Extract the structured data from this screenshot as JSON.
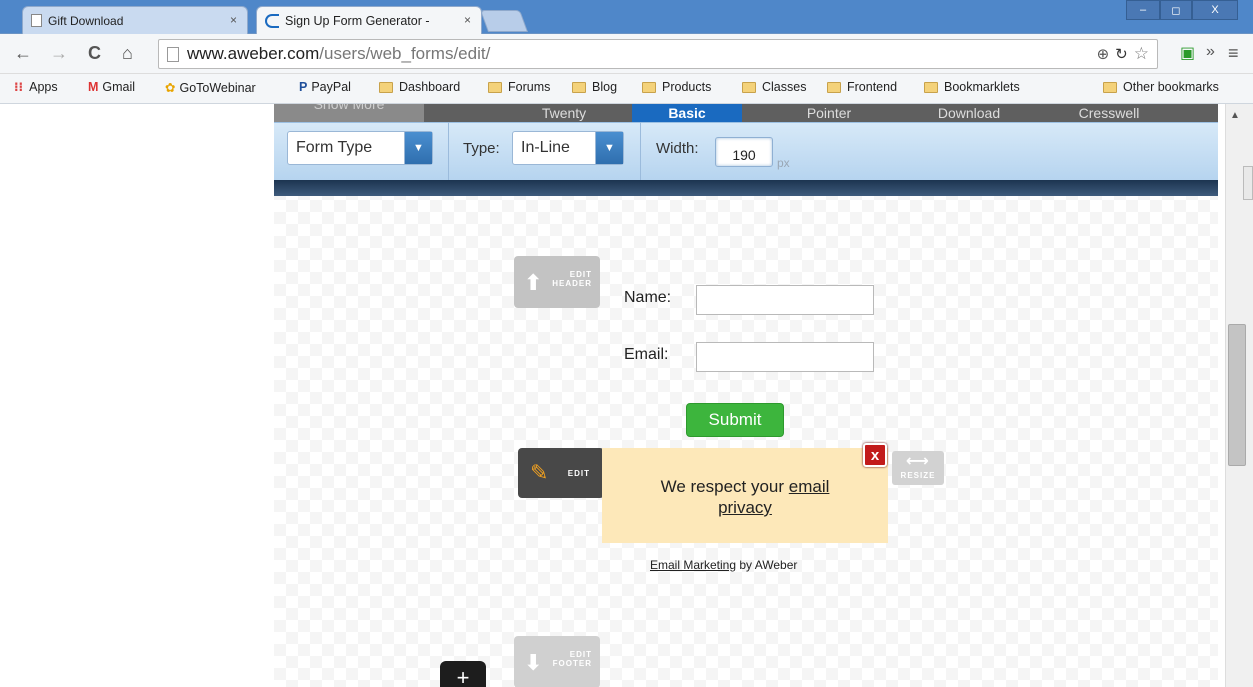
{
  "tabs": [
    {
      "title": "Gift Download",
      "close": "×"
    },
    {
      "title": "Sign Up Form Generator -",
      "close": "×"
    }
  ],
  "window_controls": {
    "minimize": "–",
    "maximize": "◻",
    "close": "X"
  },
  "toolbar": {
    "url_host": "www.aweber.com",
    "url_path": "/users/web_forms/edit/",
    "back": "←",
    "forward": "→",
    "reload": "C",
    "home": "⌂",
    "overflow": "»",
    "menu": "≡"
  },
  "bookmarks": {
    "apps": "Apps",
    "items": [
      "Gmail",
      "GoToWebinar",
      "PayPal",
      "Dashboard",
      "Forums",
      "Blog",
      "Products",
      "Classes",
      "Frontend",
      "Bookmarklets"
    ],
    "other": "Other bookmarks"
  },
  "template_bar": {
    "show_more": "Show More",
    "templates": [
      "Twenty",
      "Basic",
      "Pointer",
      "Download",
      "Cresswell"
    ],
    "active": "Basic"
  },
  "options": {
    "form_type": "Form Type",
    "type_label": "Type:",
    "type_value": "In-Line",
    "width_label": "Width:",
    "width_value": "190",
    "width_unit": "px"
  },
  "form": {
    "edit_header": [
      "EDIT",
      "HEADER"
    ],
    "name_label": "Name:",
    "email_label": "Email:",
    "submit": "Submit",
    "edit": "EDIT",
    "privacy_prefix": "We respect your ",
    "privacy_link_1": "email",
    "privacy_link_2": "privacy",
    "close_x": "x",
    "resize": "RESIZE",
    "credit_link": "Email Marketing",
    "credit_suffix": " by AWeber",
    "edit_footer": [
      "EDIT",
      "FOOTER"
    ],
    "add": "+"
  }
}
